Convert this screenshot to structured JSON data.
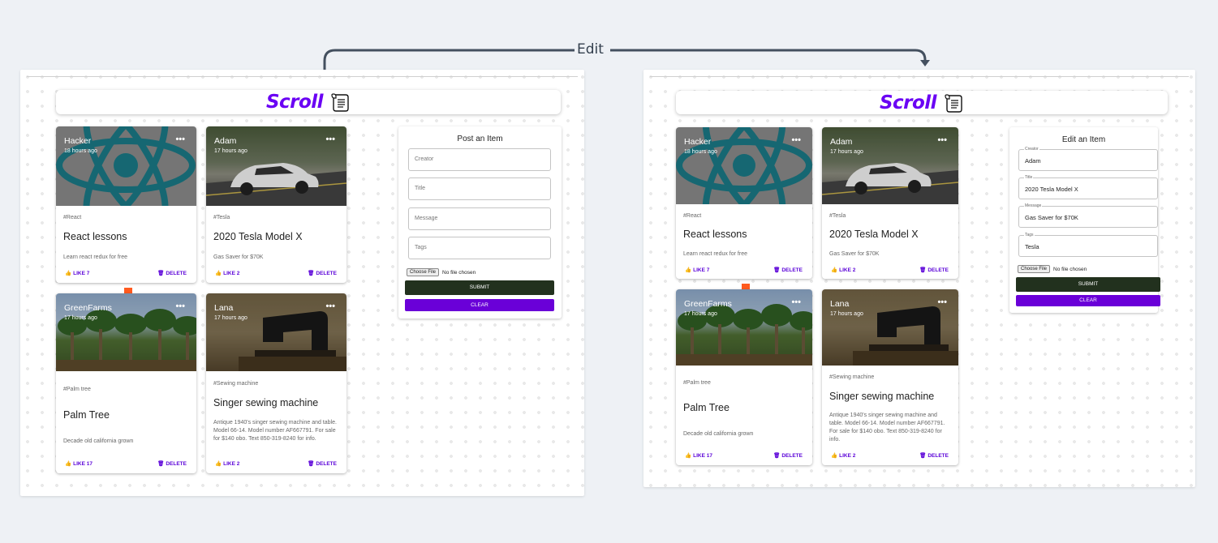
{
  "annotation": {
    "edit_label": "Edit",
    "color": "#44505f"
  },
  "logo": {
    "text": "Scroll",
    "color": "#6a00f4"
  },
  "left": {
    "form": {
      "title": "Post an Item",
      "fields": [
        {
          "placeholder": "Creator"
        },
        {
          "placeholder": "Title"
        },
        {
          "placeholder": "Message"
        },
        {
          "placeholder": "Tags"
        }
      ],
      "file_button": "Choose File",
      "file_status": "No file chosen",
      "submit": "SUBMIT",
      "clear": "CLEAR"
    },
    "cards": [
      {
        "creator": "Hacker",
        "time": "18 hours ago",
        "tag": "#React",
        "title": "React lessons",
        "message": "Learn react redux for free",
        "like": "LIKE 7",
        "delete": "DELETE",
        "image": "react-logo"
      },
      {
        "creator": "Adam",
        "time": "17 hours ago",
        "tag": "#Tesla",
        "title": "2020 Tesla Model X",
        "message": "Gas Saver for $70K",
        "like": "LIKE 2",
        "delete": "DELETE",
        "image": "tesla-car"
      },
      {
        "creator": "GreenFarms",
        "time": "17 hours ago",
        "tag": "#Palm tree",
        "title": "Palm Tree",
        "message": "Decade old california grown",
        "like": "LIKE 17",
        "delete": "DELETE",
        "image": "palm-trees"
      },
      {
        "creator": "Lana",
        "time": "17 hours ago",
        "tag": "#Sewing machine",
        "title": "Singer sewing machine",
        "message": "Antique 1940's singer sewing machine and table. Model 66-14. Model number AF667791. For sale for $140 obo. Text 850-319-8240 for info.",
        "like": "LIKE 2",
        "delete": "DELETE",
        "image": "sewing-machine"
      }
    ]
  },
  "right": {
    "form": {
      "title": "Edit an Item",
      "fields": [
        {
          "label": "Creator",
          "value": "Adam"
        },
        {
          "label": "Title",
          "value": "2020 Tesla Model X"
        },
        {
          "label": "Message",
          "value": "Gas Saver for $70K"
        },
        {
          "label": "Tags",
          "value": "Tesla"
        }
      ],
      "file_button": "Choose File",
      "file_status": "No file chosen",
      "submit": "SUBMIT",
      "clear": "CLEAR"
    },
    "cards": [
      {
        "creator": "Hacker",
        "time": "18 hours ago",
        "tag": "#React",
        "title": "React lessons",
        "message": "Learn react redux for free",
        "like": "LIKE 7",
        "delete": "DELETE",
        "image": "react-logo"
      },
      {
        "creator": "Adam",
        "time": "17 hours ago",
        "tag": "#Tesla",
        "title": "2020 Tesla Model X",
        "message": "Gas Saver for $70K",
        "like": "LIKE 2",
        "delete": "DELETE",
        "image": "tesla-car"
      },
      {
        "creator": "GreenFarms",
        "time": "17 hours ago",
        "tag": "#Palm tree",
        "title": "Palm Tree",
        "message": "Decade old california grown",
        "like": "LIKE 17",
        "delete": "DELETE",
        "image": "palm-trees"
      },
      {
        "creator": "Lana",
        "time": "17 hours ago",
        "tag": "#Sewing machine",
        "title": "Singer sewing machine",
        "message": "Antique 1940's singer sewing machine and table. Model 66-14. Model number AF667791. For sale for $140 obo. Text 850-319-8240 for info.",
        "like": "LIKE 2",
        "delete": "DELETE",
        "image": "sewing-machine"
      }
    ]
  }
}
